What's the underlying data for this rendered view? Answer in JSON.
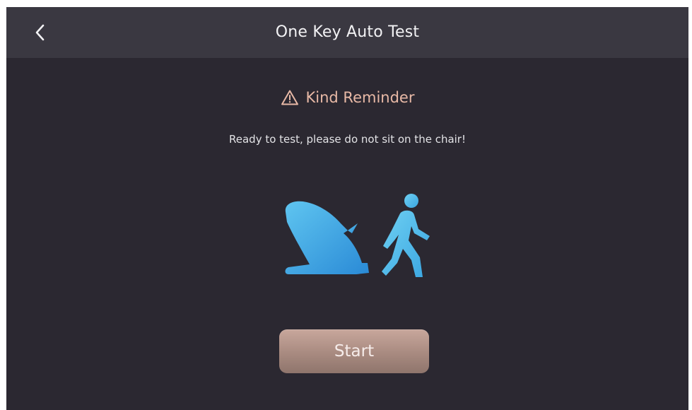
{
  "header": {
    "title": "One Key Auto Test",
    "back_icon": "chevron-left-icon"
  },
  "reminder": {
    "icon": "warning-triangle-icon",
    "title": "Kind Reminder",
    "color": "#e8b9a6"
  },
  "message": "Ready to test, please do not sit on the chair!",
  "illustration": {
    "icons": [
      "massage-chair-icon",
      "walking-person-icon"
    ],
    "gradient": [
      "#2a8ad6",
      "#5fc5f0"
    ]
  },
  "start_button": {
    "label": "Start"
  },
  "colors": {
    "background": "#2b2831",
    "header": "#3a3841",
    "button": "#b0928a"
  }
}
